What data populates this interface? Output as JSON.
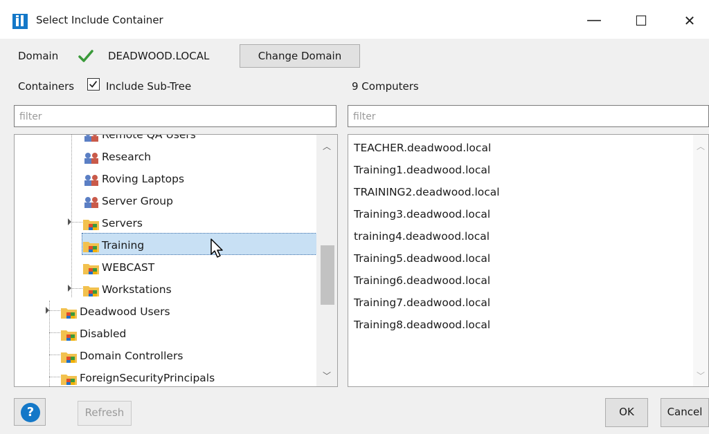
{
  "window": {
    "title": "Select Include Container",
    "minimize_glyph": "—",
    "maximize_glyph": "☐",
    "close_glyph": "✕"
  },
  "domain": {
    "label": "Domain",
    "value": "DEADWOOD.LOCAL",
    "change_button": "Change Domain"
  },
  "containers": {
    "label": "Containers",
    "include_subtree_label": "Include Sub-Tree",
    "include_subtree_checked": true,
    "filter_placeholder": "filter",
    "tree": [
      {
        "label": "Remote QA Users",
        "icon": "group-icon"
      },
      {
        "label": "Research",
        "icon": "group-icon"
      },
      {
        "label": "Roving Laptops",
        "icon": "group-icon"
      },
      {
        "label": "Server Group",
        "icon": "group-icon"
      },
      {
        "label": "Servers",
        "icon": "folder-icon"
      },
      {
        "label": "Training",
        "icon": "folder-icon",
        "selected": true
      },
      {
        "label": "WEBCAST",
        "icon": "folder-icon"
      },
      {
        "label": "Workstations",
        "icon": "folder-icon"
      },
      {
        "label": "Deadwood Users",
        "icon": "folder-icon"
      },
      {
        "label": "Disabled",
        "icon": "folder-icon"
      },
      {
        "label": "Domain Controllers",
        "icon": "folder-icon"
      },
      {
        "label": "ForeignSecurityPrincipals",
        "icon": "folder-icon"
      }
    ]
  },
  "computers": {
    "header": "9 Computers",
    "filter_placeholder": "filter",
    "items": [
      "TEACHER.deadwood.local",
      "Training1.deadwood.local",
      "TRAINING2.deadwood.local",
      "Training3.deadwood.local",
      "training4.deadwood.local",
      "Training5.deadwood.local",
      "Training6.deadwood.local",
      "Training7.deadwood.local",
      "Training8.deadwood.local"
    ]
  },
  "footer": {
    "help_glyph": "?",
    "refresh_label": "Refresh",
    "ok_label": "OK",
    "cancel_label": "Cancel"
  },
  "colors": {
    "accent": "#1478c8",
    "check": "#3a9a3a",
    "selection": "#c8e0f4",
    "folder": "#f2c14e"
  }
}
